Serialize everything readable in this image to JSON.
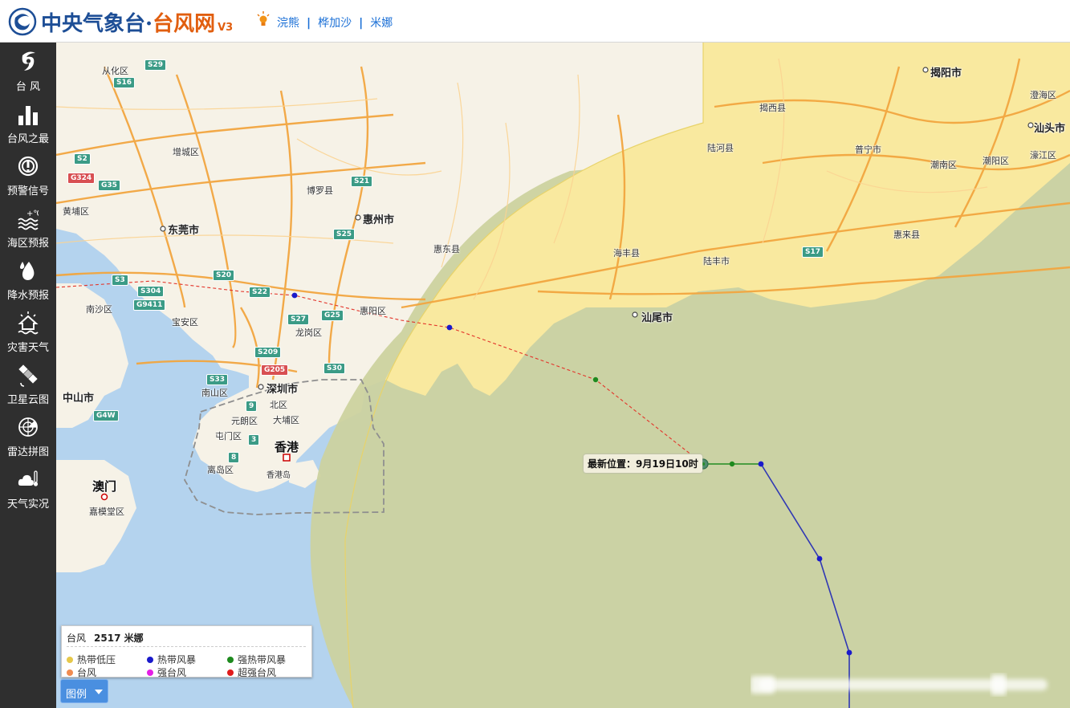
{
  "header": {
    "title_main": "中央气象台·",
    "title_accent": "台风网",
    "version": "V3",
    "storms": [
      "浣熊",
      "桦加沙",
      "米娜"
    ]
  },
  "sidebar": {
    "items": [
      {
        "label": "台 风",
        "icon": "typhoon-icon"
      },
      {
        "label": "台风之最",
        "icon": "bar-chart-icon"
      },
      {
        "label": "预警信号",
        "icon": "warning-signal-icon"
      },
      {
        "label": "海区预报",
        "icon": "sea-temperature-icon"
      },
      {
        "label": "降水预报",
        "icon": "rain-drop-icon"
      },
      {
        "label": "灾害天气",
        "icon": "disaster-weather-icon"
      },
      {
        "label": "卫星云图",
        "icon": "satellite-icon"
      },
      {
        "label": "雷达拼图",
        "icon": "radar-icon"
      },
      {
        "label": "天气实况",
        "icon": "cloud-thermometer-icon"
      }
    ]
  },
  "map": {
    "cities": {
      "conghua": "从化区",
      "zengcheng": "增城区",
      "huangpu": "黄埔区",
      "dongguan": "东莞市",
      "boluo": "博罗县",
      "huizhou": "惠州市",
      "huidong": "惠东县",
      "huiyang": "惠阳区",
      "nansha": "南沙区",
      "baoan": "宝安区",
      "longgang": "龙岗区",
      "nanshan": "南山区",
      "shenzhen": "深圳市",
      "beiqu": "北区",
      "yuanlang": "元朗区",
      "dapu": "大埔区",
      "tunmen": "屯门区",
      "xianggang": "香港",
      "xianggangdao": "香港岛",
      "lidao": "离岛区",
      "zhongshan": "中山市",
      "aomen": "澳门",
      "jiamotang": "嘉模堂区",
      "jiexi": "揭西县",
      "jieyang": "揭阳市",
      "luhe": "陆河县",
      "puning": "普宁市",
      "chaonan": "潮南区",
      "chaoyang": "潮阳区",
      "shantou": "汕头市",
      "chenghai": "澄海区",
      "haojiang": "濠江区",
      "huilai": "惠来县",
      "haifeng": "海丰县",
      "lufeng": "陆丰市",
      "shanwei": "汕尾市"
    },
    "roads": {
      "s29": "S29",
      "s16": "S16",
      "s2": "S2",
      "g324": "G324",
      "g35": "G35",
      "s21": "S21",
      "s25": "S25",
      "s3": "S3",
      "s304": "S304",
      "g9411": "G9411",
      "s20": "S20",
      "s22": "S22",
      "s27": "S27",
      "g25": "G25",
      "s209": "S209",
      "g205": "G205",
      "s33": "S33",
      "s30": "S30",
      "r9": "9",
      "r3": "3",
      "r8": "8",
      "g4w": "G4W",
      "s17": "S17"
    },
    "latest_position": "最新位置：9月19日10时"
  },
  "legend": {
    "title": "台风",
    "storm": "2517 米娜",
    "items": [
      {
        "label": "热带低压",
        "color": "#e6c84a"
      },
      {
        "label": "热带风暴",
        "color": "#1a1acb"
      },
      {
        "label": "强热带风暴",
        "color": "#1e8a1e"
      },
      {
        "label": "台风",
        "color": "#f08b50"
      },
      {
        "label": "强台风",
        "color": "#e51fe5"
      },
      {
        "label": "超强台风",
        "color": "#e01b1b"
      }
    ],
    "button_label": "图例"
  }
}
